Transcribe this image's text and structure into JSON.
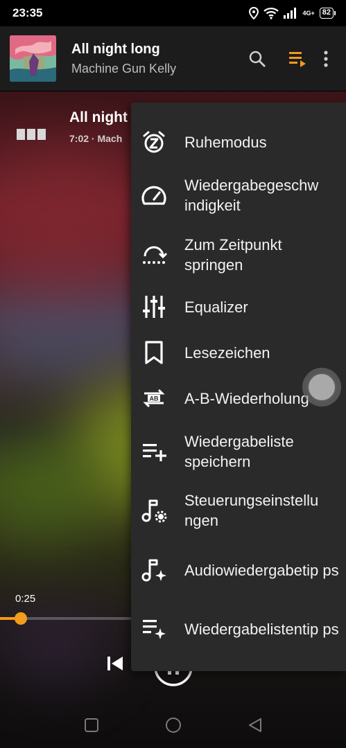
{
  "status": {
    "time": "23:35",
    "network": "4G+",
    "battery": "82"
  },
  "header": {
    "title": "All night long",
    "artist": "Machine Gun Kelly",
    "icons": [
      "search-icon",
      "queue-icon",
      "more-vert-icon"
    ],
    "accent": "#f39b1a"
  },
  "now_playing": {
    "title": "All night",
    "sub": "7:02 · Mach"
  },
  "player": {
    "elapsed": "0:25",
    "progress": 0.06
  },
  "menu": {
    "items": [
      {
        "label": "Ruhemodus",
        "icon": "alarm-z-icon"
      },
      {
        "label": "Wiedergabegeschw indigkeit",
        "icon": "speedometer-icon"
      },
      {
        "label": "Zum Zeitpunkt springen",
        "icon": "jump-to-time-icon"
      },
      {
        "label": "Equalizer",
        "icon": "equalizer-icon"
      },
      {
        "label": "Lesezeichen",
        "icon": "bookmark-icon"
      },
      {
        "label": "A-B-Wiederholung",
        "icon": "ab-repeat-icon"
      },
      {
        "label": "Wiedergabeliste speichern",
        "icon": "playlist-add-icon"
      },
      {
        "label": "Steuerungseinstellu ngen",
        "icon": "music-settings-icon"
      },
      {
        "label": "Audiowiedergabetip ps",
        "icon": "music-tips-icon"
      },
      {
        "label": "Wiedergabelistentip ps",
        "icon": "playlist-tips-icon"
      }
    ]
  }
}
